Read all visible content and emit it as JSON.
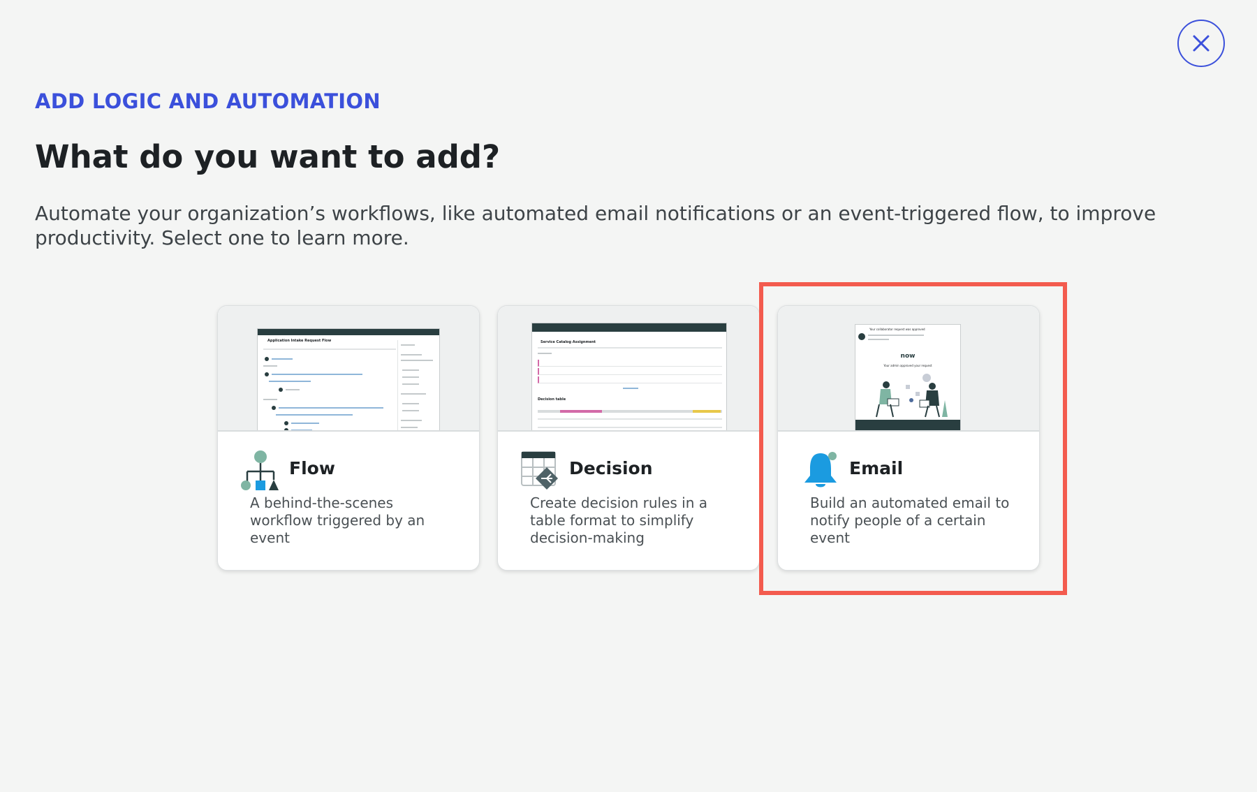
{
  "header": {
    "eyebrow": "ADD LOGIC AND AUTOMATION",
    "title": "What do you want to add?",
    "description": "Automate your organization’s workflows, like automated email notifications or an event-triggered flow, to improve productivity. Select one to learn more."
  },
  "cards": [
    {
      "title": "Flow",
      "description": "A behind-the-scenes workflow triggered by an event",
      "icon": "flow-icon",
      "preview": {
        "app_title": "Application Intake Request Flow"
      }
    },
    {
      "title": "Decision",
      "description": "Create decision rules in a table format to simplify decision-making",
      "icon": "decision-table-icon",
      "preview": {
        "app_title": "Service Catalog Assignment",
        "section": "Decision table"
      }
    },
    {
      "title": "Email",
      "description": "Build an automated email to notify people of a certain event",
      "icon": "bell-icon",
      "preview": {
        "subject": "Your collaborator request was approved",
        "brand": "now",
        "headline": "Your admin approved your request"
      }
    }
  ],
  "colors": {
    "accent": "#3b50db",
    "highlight": "#f35b4e",
    "icon_blue": "#1b9be0",
    "icon_teal": "#7fb5a3",
    "dark": "#293e40"
  },
  "selected_card": "Email"
}
